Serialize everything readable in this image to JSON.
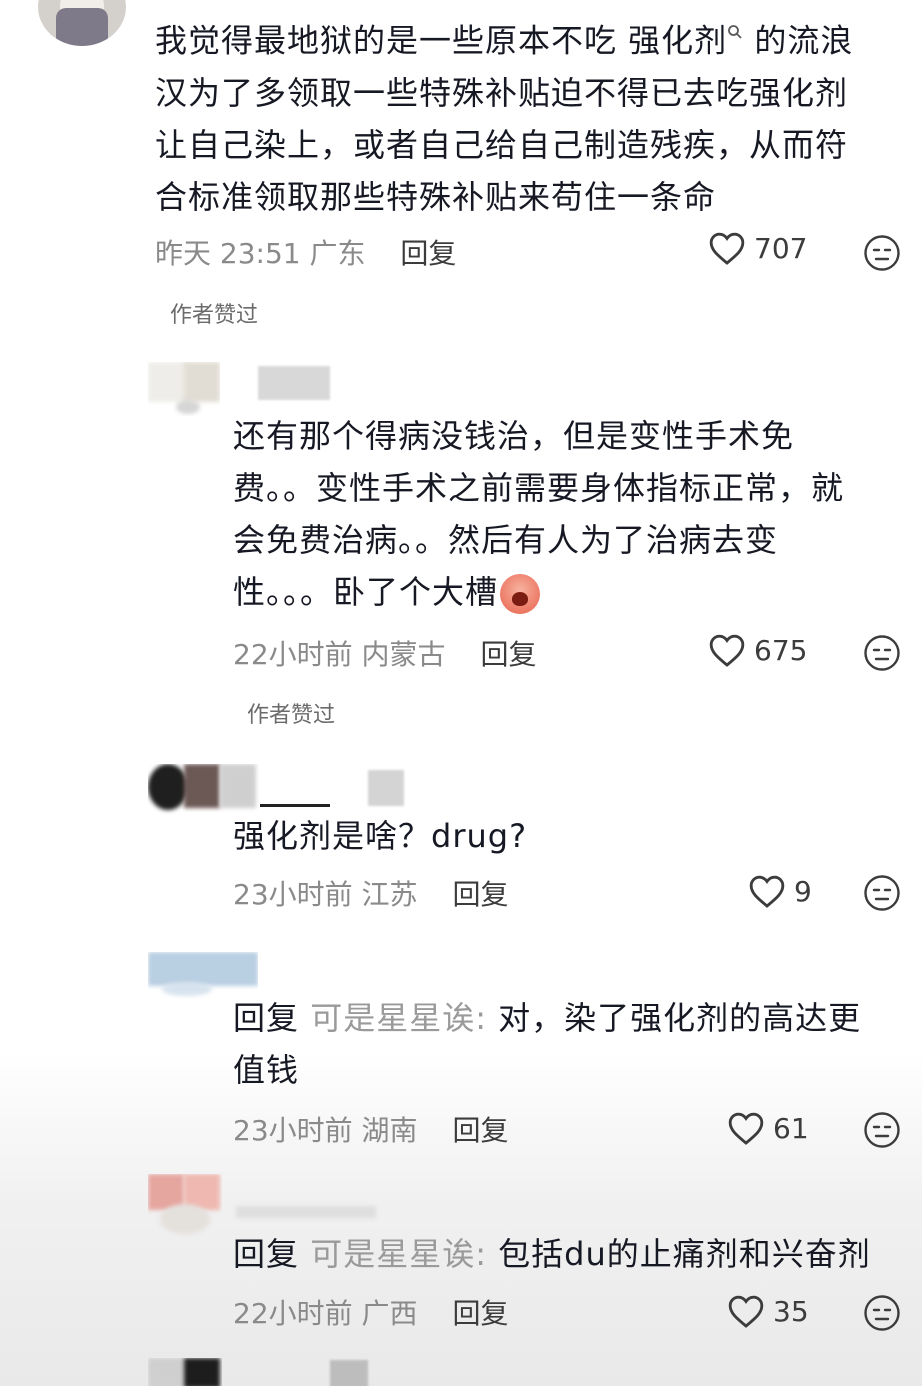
{
  "comments": [
    {
      "text_lines": [
        "我觉得最地狱的是一些原本不吃 强化剂",
        " 的流浪",
        "汉为了多领取一些特殊补贴迫不得已去吃强化剂",
        "让自己染上，或者自己给自己制造残疾，从而符",
        "合标准领取那些特殊补贴来苟住一条命"
      ],
      "search_hint_icon": "search-icon",
      "time": "昨天 23:51",
      "location": "广东",
      "reply_label": "回复",
      "likes": "707",
      "author_badge": "作者赞过"
    },
    {
      "text_lines": [
        "还有那个得病没钱治，但是变性手术免",
        "费。。变性手术之前需要身体指标正常，就",
        "会免费治病。。然后有人为了治病去变",
        "性。。。卧了个大槽"
      ],
      "time": "22小时前",
      "location": "内蒙古",
      "reply_label": "回复",
      "likes": "675",
      "author_badge": "作者赞过"
    },
    {
      "text_lines": [
        "强化剂是啥？drug?"
      ],
      "time": "23小时前",
      "location": "江苏",
      "reply_label": "回复",
      "likes": "9"
    },
    {
      "reply_prefix": "回复",
      "reply_target": "可是星星诶:",
      "text_lines": [
        " 对，染了强化剂的高达更",
        "值钱"
      ],
      "time": "23小时前",
      "location": "湖南",
      "reply_label": "回复",
      "likes": "61"
    },
    {
      "reply_prefix": "回复",
      "reply_target": "可是星星诶:",
      "text_lines": [
        " 包括du的止痛剂和兴奋剂"
      ],
      "time": "22小时前",
      "location": "广西",
      "reply_label": "回复",
      "likes": "35"
    }
  ],
  "colors": {
    "text": "#161823",
    "meta": "#8a8a8a",
    "reply_target": "#9a9a9a",
    "emoji": "#e7604a"
  },
  "icons": [
    "heart-icon",
    "dislike-face-icon",
    "search-icon",
    "crying-emoji-icon"
  ]
}
